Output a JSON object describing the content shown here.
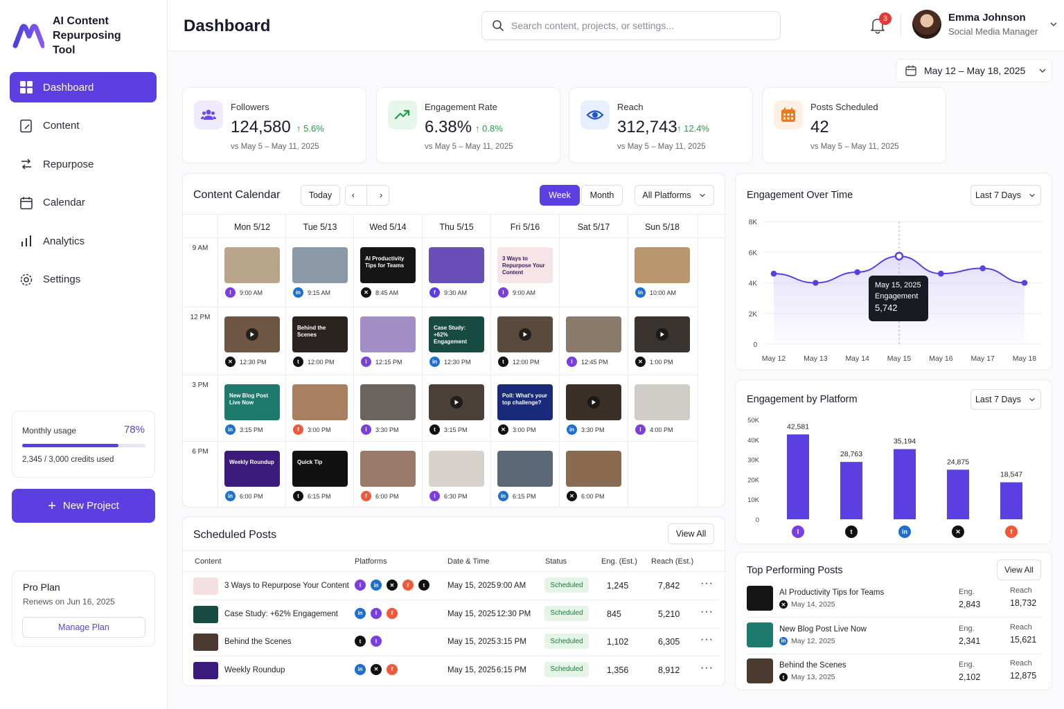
{
  "app": {
    "name": "AI Content Repurposing Tool"
  },
  "sidebar": {
    "items": [
      {
        "label": "Dashboard",
        "icon": "dashboard-icon",
        "active": true
      },
      {
        "label": "Content",
        "icon": "content-icon"
      },
      {
        "label": "Repurpose",
        "icon": "repurpose-icon"
      },
      {
        "label": "Calendar",
        "icon": "calendar-icon"
      },
      {
        "label": "Analytics",
        "icon": "analytics-icon"
      },
      {
        "label": "Settings",
        "icon": "settings-icon"
      }
    ],
    "usage": {
      "label": "Monthly usage",
      "percent": "78%",
      "fraction": 0.78,
      "detail": "2,345 / 3,000 credits used"
    },
    "new_project": "New Project",
    "plan": {
      "name": "Pro Plan",
      "renews": "Renews on Jun 16, 2025",
      "manage": "Manage Plan"
    }
  },
  "header": {
    "title": "Dashboard",
    "search_placeholder": "Search content, projects, or settings...",
    "notifications": "3",
    "user": {
      "name": "Emma Johnson",
      "role": "Social Media Manager"
    }
  },
  "date_range": "May 12 – May 18, 2025",
  "stats": [
    {
      "label": "Followers",
      "value": "124,580",
      "change": "5.6%",
      "sub": "vs May 5 – May 11, 2025",
      "icon": "users-icon",
      "color": "#6a4de8",
      "bg": "#efeafd"
    },
    {
      "label": "Engagement Rate",
      "value": "6.38%",
      "change": "0.8%",
      "sub": "vs May 5 – May 11, 2025",
      "icon": "trend-icon",
      "color": "#1e9e4a",
      "bg": "#e6f6ea"
    },
    {
      "label": "Reach",
      "value": "312,743",
      "change": "12.4%",
      "sub": "vs May 5 – May 11, 2025",
      "icon": "eye-icon",
      "color": "#2255cc",
      "bg": "#e8efff"
    },
    {
      "label": "Posts Scheduled",
      "value": "42",
      "change": "",
      "sub": "vs May 5 – May 11, 2025",
      "icon": "calendar-grid-icon",
      "color": "#f07a1a",
      "bg": "#fff0e3"
    }
  ],
  "calendar": {
    "title": "Content Calendar",
    "today": "Today",
    "week": "Week",
    "month": "Month",
    "platforms": "All Platforms",
    "days": [
      "Mon 5/12",
      "Tue 5/13",
      "Wed 5/14",
      "Thu 5/15",
      "Fri 5/16",
      "Sat 5/17",
      "Sun 5/18"
    ],
    "times": [
      "9 AM",
      "12 PM",
      "3 PM",
      "6 PM"
    ],
    "slots": [
      [
        {
          "time": "9:00 AM",
          "p": "instagram",
          "bg": "#b9a58c",
          "text": ""
        },
        {
          "time": "9:15 AM",
          "p": "linkedin",
          "bg": "#8a98a8",
          "text": ""
        },
        {
          "time": "8:45 AM",
          "p": "x",
          "bg": "#151515",
          "text": "AI Productivity Tips for Teams"
        },
        {
          "time": "9:30 AM",
          "p": "facebook",
          "bg": "#6a4fb8",
          "text": ""
        },
        {
          "time": "9:00 AM",
          "p": "instagram",
          "bg": "#f7e4e6",
          "text": "3 Ways to Repurpose Your Content",
          "dark": true
        },
        null,
        {
          "time": "10:00 AM",
          "p": "linkedin",
          "bg": "#b9966e",
          "text": ""
        }
      ],
      [
        {
          "time": "12:30 PM",
          "p": "x",
          "bg": "#6e5642",
          "text": "",
          "video": true
        },
        {
          "time": "12:00 PM",
          "p": "tiktok",
          "bg": "#2a2320",
          "text": "Behind the Scenes"
        },
        {
          "time": "12:15 PM",
          "p": "instagram",
          "bg": "#a48ec8",
          "text": ""
        },
        {
          "time": "12:30 PM",
          "p": "linkedin",
          "bg": "#174a40",
          "text": "Case Study: +62% Engagement"
        },
        {
          "time": "12:00 PM",
          "p": "tiktok",
          "bg": "#5a4a3c",
          "text": "",
          "video": true
        },
        {
          "time": "12:45 PM",
          "p": "instagram",
          "bg": "#8a7a6a",
          "text": ""
        },
        {
          "time": "1:00 PM",
          "p": "x",
          "bg": "#3a3430",
          "text": "",
          "video": true
        }
      ],
      [
        {
          "time": "3:15 PM",
          "p": "linkedin",
          "bg": "#1e7a6c",
          "text": "New Blog Post Live Now"
        },
        {
          "time": "3:00 PM",
          "p": "facebook-orange",
          "bg": "#a88060",
          "text": ""
        },
        {
          "time": "3:30 PM",
          "p": "instagram",
          "bg": "#6a6460",
          "text": ""
        },
        {
          "time": "3:15 PM",
          "p": "tiktok",
          "bg": "#4a4038",
          "text": "",
          "video": true
        },
        {
          "time": "3:00 PM",
          "p": "x",
          "bg": "#1a2a7a",
          "text": "Poll: What's your top challenge?"
        },
        {
          "time": "3:30 PM",
          "p": "linkedin",
          "bg": "#3a3028",
          "text": "",
          "video": true
        },
        {
          "time": "4:00 PM",
          "p": "instagram",
          "bg": "#d0ccc8",
          "text": ""
        }
      ],
      [
        {
          "time": "6:00 PM",
          "p": "linkedin",
          "bg": "#3a1a7a",
          "text": "Weekly Roundup"
        },
        {
          "time": "6:15 PM",
          "p": "tiktok",
          "bg": "#111111",
          "text": "Quick Tip"
        },
        {
          "time": "6:00 PM",
          "p": "facebook-orange",
          "bg": "#9a7a6a",
          "text": ""
        },
        {
          "time": "6:30 PM",
          "p": "instagram",
          "bg": "#d8d2cc",
          "text": ""
        },
        {
          "time": "6:15 PM",
          "p": "linkedin",
          "bg": "#5a6878",
          "text": ""
        },
        {
          "time": "6:00 PM",
          "p": "x",
          "bg": "#8a6a50",
          "text": ""
        },
        null
      ]
    ]
  },
  "scheduled": {
    "title": "Scheduled Posts",
    "view_all": "View All",
    "columns": [
      "Content",
      "Platforms",
      "Date & Time",
      "Status",
      "Eng. (Est.)",
      "Reach (Est.)"
    ],
    "rows": [
      {
        "content": "3 Ways to Repurpose Your Content",
        "platforms": [
          "instagram",
          "linkedin",
          "x",
          "facebook-orange",
          "tiktok"
        ],
        "date": "May 15, 2025",
        "time": "9:00 AM",
        "status": "Scheduled",
        "eng": "1,245",
        "reach": "7,842",
        "thumb": "#f4dfe2"
      },
      {
        "content": "Case Study: +62% Engagement",
        "platforms": [
          "linkedin",
          "instagram",
          "facebook-orange"
        ],
        "date": "May 15, 2025",
        "time": "12:30 PM",
        "status": "Scheduled",
        "eng": "845",
        "reach": "5,210",
        "thumb": "#174a40"
      },
      {
        "content": "Behind the Scenes",
        "platforms": [
          "tiktok",
          "instagram"
        ],
        "date": "May 15, 2025",
        "time": "3:15 PM",
        "status": "Scheduled",
        "eng": "1,102",
        "reach": "6,305",
        "thumb": "#4a3a30"
      },
      {
        "content": "Weekly Roundup",
        "platforms": [
          "linkedin",
          "x",
          "facebook-orange"
        ],
        "date": "May 15, 2025",
        "time": "6:15 PM",
        "status": "Scheduled",
        "eng": "1,356",
        "reach": "8,912",
        "thumb": "#3a1a7a"
      }
    ]
  },
  "engagement_over_time": {
    "title": "Engagement Over Time",
    "range": "Last 7 Days",
    "tooltip": {
      "date": "May 15, 2025",
      "label": "Engagement",
      "value": "5,742"
    }
  },
  "engagement_by_platform": {
    "title": "Engagement by Platform",
    "range": "Last 7 Days"
  },
  "chart_data": [
    {
      "type": "line",
      "title": "Engagement Over Time",
      "categories": [
        "May 12",
        "May 13",
        "May 14",
        "May 15",
        "May 16",
        "May 17",
        "May 18"
      ],
      "values": [
        4600,
        4000,
        4700,
        5742,
        4600,
        4950,
        4000
      ],
      "ylim": [
        0,
        8000
      ],
      "yticks": [
        "0",
        "2K",
        "4K",
        "6K",
        "8K"
      ],
      "grid": true,
      "color": "#5b3fe0"
    },
    {
      "type": "bar",
      "title": "Engagement by Platform",
      "categories": [
        "instagram",
        "tiktok",
        "linkedin",
        "x",
        "facebook-orange"
      ],
      "values": [
        42581,
        28763,
        35194,
        24875,
        18547
      ],
      "labels": [
        "42,581",
        "28,763",
        "35,194",
        "24,875",
        "18,547"
      ],
      "ylim": [
        0,
        50000
      ],
      "yticks": [
        "0",
        "10K",
        "20K",
        "30K",
        "40K",
        "50K"
      ],
      "color": "#5b3fe0"
    }
  ],
  "top_posts": {
    "title": "Top Performing Posts",
    "view_all": "View All",
    "eng_label": "Eng.",
    "reach_label": "Reach",
    "items": [
      {
        "title": "AI Productivity Tips for Teams",
        "p": "x",
        "date": "May 14, 2025",
        "eng": "2,843",
        "reach": "18,732",
        "thumb": "#151515"
      },
      {
        "title": "New Blog Post Live Now",
        "p": "linkedin",
        "date": "May 12, 2025",
        "eng": "2,341",
        "reach": "15,621",
        "thumb": "#1e7a6c"
      },
      {
        "title": "Behind the Scenes",
        "p": "tiktok",
        "date": "May 13, 2025",
        "eng": "2,102",
        "reach": "12,875",
        "thumb": "#4a3a30"
      }
    ]
  },
  "platform_icons": {
    "instagram": {
      "color": "#7b3fe0",
      "glyph": "I"
    },
    "linkedin": {
      "color": "#1e6fd0",
      "glyph": "in"
    },
    "x": {
      "color": "#111111",
      "glyph": "✕"
    },
    "facebook": {
      "color": "#5b3fe0",
      "glyph": "f"
    },
    "facebook-orange": {
      "color": "#f05a3a",
      "glyph": "f"
    },
    "tiktok": {
      "color": "#111111",
      "glyph": "t"
    }
  }
}
